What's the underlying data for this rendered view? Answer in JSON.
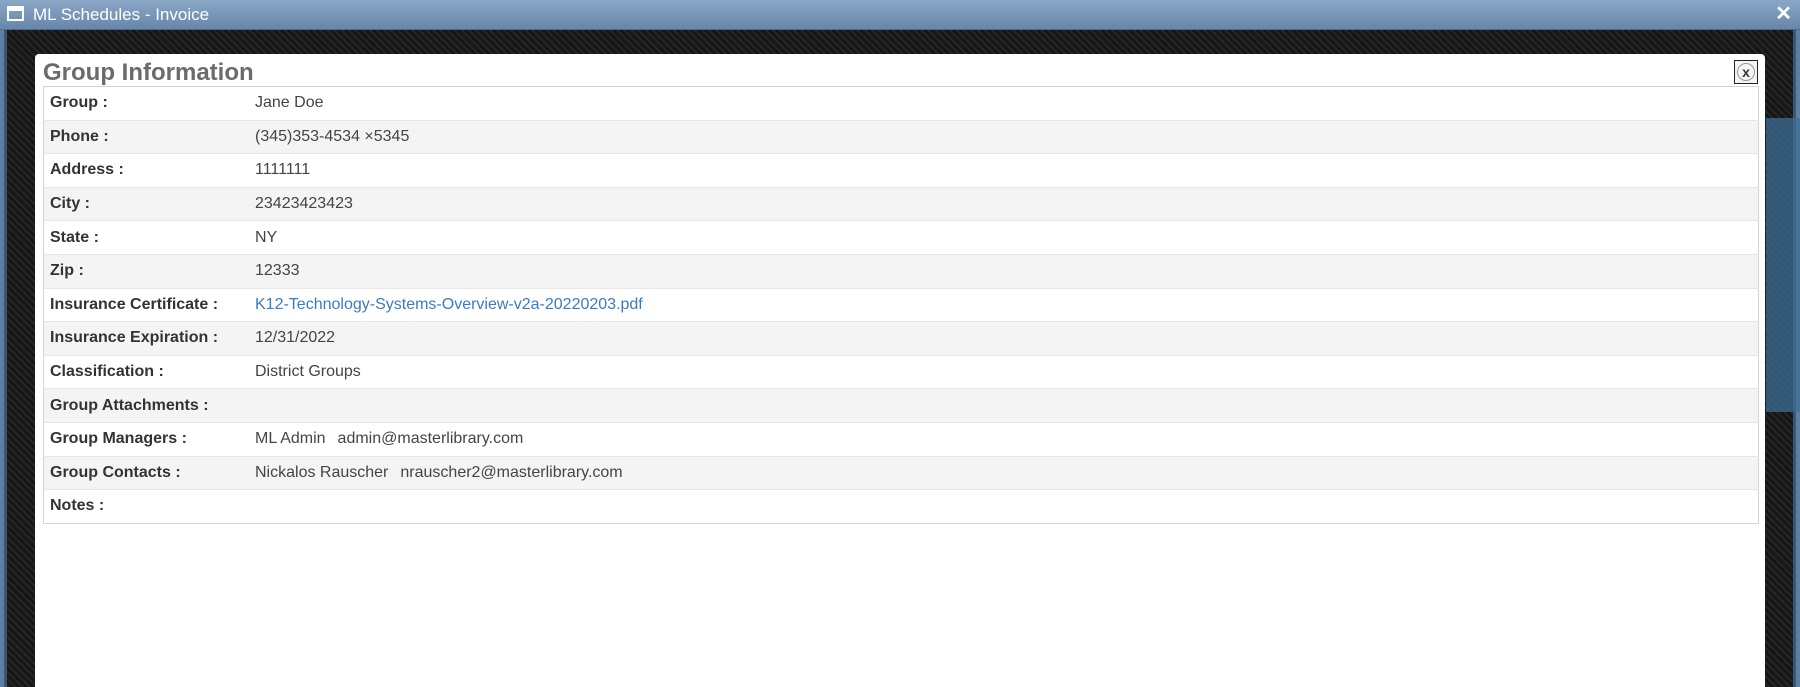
{
  "window": {
    "title": "ML Schedules - Invoice",
    "close_label": "✕"
  },
  "modal": {
    "title": "Group Information",
    "close_label": "x",
    "rows": {
      "group": {
        "label": "Group :",
        "value": "Jane Doe"
      },
      "phone": {
        "label": "Phone :",
        "value": "(345)353-4534 ×5345"
      },
      "address": {
        "label": "Address :",
        "value": "1111111"
      },
      "city": {
        "label": "City :",
        "value": "23423423423"
      },
      "state": {
        "label": "State :",
        "value": "NY"
      },
      "zip": {
        "label": "Zip :",
        "value": "12333"
      },
      "insurance_certificate": {
        "label": "Insurance Certificate :",
        "value": "K12-Technology-Systems-Overview-v2a-20220203.pdf"
      },
      "insurance_expiration": {
        "label": "Insurance Expiration :",
        "value": "12/31/2022"
      },
      "classification": {
        "label": "Classification :",
        "value": "District Groups"
      },
      "group_attachments": {
        "label": "Group Attachments :",
        "value": ""
      },
      "group_managers": {
        "label": "Group Managers :",
        "name": "ML Admin",
        "email": "admin@masterlibrary.com"
      },
      "group_contacts": {
        "label": "Group Contacts :",
        "name": "Nickalos Rauscher",
        "email": "nrauscher2@masterlibrary.com"
      },
      "notes": {
        "label": "Notes :",
        "value": ""
      }
    }
  }
}
